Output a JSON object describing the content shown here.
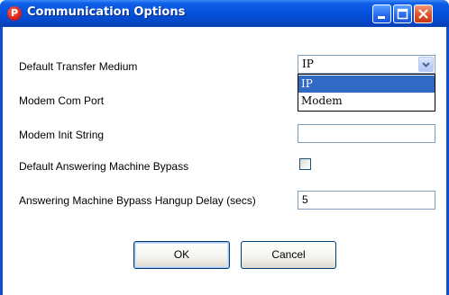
{
  "window": {
    "title": "Communication Options",
    "app_icon_glyph": "P",
    "icon": "red-p-app-icon"
  },
  "fields": {
    "transfer_medium_label": "Default Transfer Medium",
    "modem_com_port_label": "Modem Com Port",
    "modem_init_string_label": "Modem Init String",
    "modem_init_string_value": "",
    "answering_bypass_label": "Default Answering Machine Bypass",
    "answering_bypass_checked": false,
    "hangup_delay_label": "Answering Machine Bypass Hangup Delay (secs)",
    "hangup_delay_value": "5"
  },
  "transfer_medium": {
    "selected": "IP",
    "options": [
      "IP",
      "Modem"
    ],
    "highlighted_index": 0
  },
  "buttons": {
    "ok_label": "OK",
    "cancel_label": "Cancel"
  },
  "colors": {
    "titlebar": "#0552dc",
    "selection": "#316ac5",
    "close_button": "#e0502a"
  }
}
